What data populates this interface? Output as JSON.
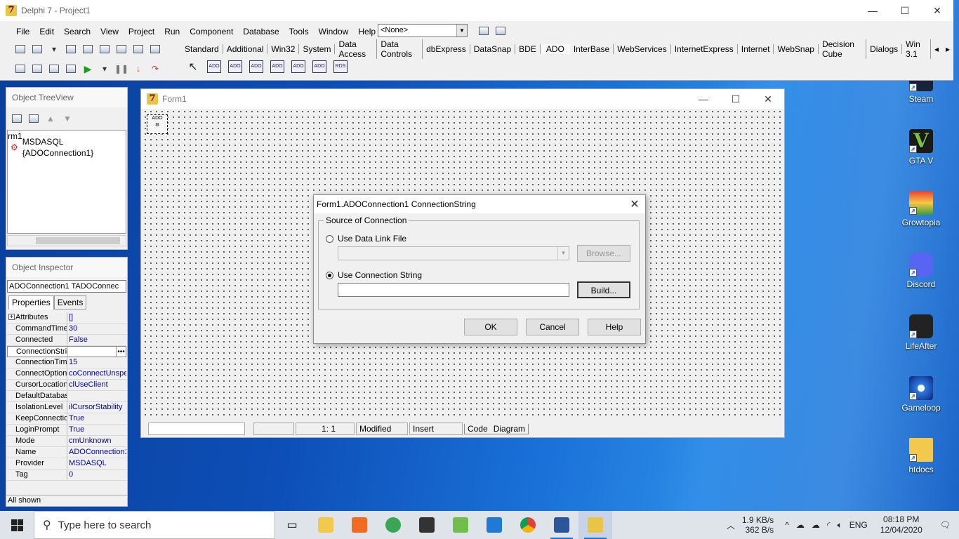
{
  "desktop": {
    "icons_right": [
      {
        "label": "Steam",
        "icon": "steam-icon"
      },
      {
        "label": "GTA V",
        "icon": "gta-icon"
      },
      {
        "label": "Growtopia",
        "icon": "growtopia-icon"
      },
      {
        "label": "Discord",
        "icon": "discord-icon"
      },
      {
        "label": "LifeAfter",
        "icon": "lifeafter-icon"
      },
      {
        "label": "Gameloop",
        "icon": "gameloop-icon"
      },
      {
        "label": "htdocs",
        "icon": "folder-icon"
      }
    ]
  },
  "main_window": {
    "title": "Delphi 7 - Project1",
    "menu": [
      "File",
      "Edit",
      "Search",
      "View",
      "Project",
      "Run",
      "Component",
      "Database",
      "Tools",
      "Window",
      "Help"
    ],
    "config_combo": "<None>",
    "palette_tabs": [
      "Standard",
      "Additional",
      "Win32",
      "System",
      "Data Access",
      "Data Controls",
      "dbExpress",
      "DataSnap",
      "BDE",
      "ADO",
      "InterBase",
      "WebServices",
      "InternetExpress",
      "Internet",
      "WebSnap",
      "Decision Cube",
      "Dialogs",
      "Win 3.1"
    ],
    "active_palette_tab": "ADO",
    "palette_components": [
      "ADO",
      "ADO",
      "ADO",
      "ADO",
      "ADO",
      "ADO",
      "RDS"
    ]
  },
  "object_treeview": {
    "title": "Object TreeView",
    "items": [
      "rm1",
      "MSDASQL {ADOConnection1}"
    ]
  },
  "object_inspector": {
    "title": "Object Inspector",
    "selector": "ADOConnection1   TADOConnec",
    "tabs": [
      "Properties",
      "Events"
    ],
    "properties": [
      {
        "name": "Attributes",
        "value": "[]"
      },
      {
        "name": "CommandTime",
        "value": "30"
      },
      {
        "name": "Connected",
        "value": "False"
      },
      {
        "name": "ConnectionStri",
        "value": ""
      },
      {
        "name": "ConnectionTim",
        "value": "15"
      },
      {
        "name": "ConnectOption",
        "value": "coConnectUnspe"
      },
      {
        "name": "CursorLocation",
        "value": "clUseClient"
      },
      {
        "name": "DefaultDatabas",
        "value": ""
      },
      {
        "name": "IsolationLevel",
        "value": "ilCursorStability"
      },
      {
        "name": "KeepConnectio",
        "value": "True"
      },
      {
        "name": "LoginPrompt",
        "value": "True"
      },
      {
        "name": "Mode",
        "value": "cmUnknown"
      },
      {
        "name": "Name",
        "value": "ADOConnection1"
      },
      {
        "name": "Provider",
        "value": "MSDASQL"
      },
      {
        "name": "Tag",
        "value": "0"
      }
    ],
    "footer": "All shown"
  },
  "form1": {
    "title": "Form1",
    "status": {
      "position": "1:   1",
      "modified": "Modified",
      "mode": "Insert",
      "tab_code": "Code",
      "tab_diagram": "Diagram"
    }
  },
  "dialog": {
    "title": "Form1.ADOConnection1 ConnectionString",
    "group_label": "Source of Connection",
    "radio_file": "Use Data Link File",
    "radio_string": "Use Connection String",
    "browse": "Browse...",
    "build": "Build...",
    "ok": "OK",
    "cancel": "Cancel",
    "help": "Help",
    "connection_string_value": ""
  },
  "taskbar": {
    "search_placeholder": "Type here to search",
    "net_up": "1.9 KB/s",
    "net_down": "362 B/s",
    "language": "ENG",
    "time": "08:18 PM",
    "date": "12/04/2020"
  }
}
